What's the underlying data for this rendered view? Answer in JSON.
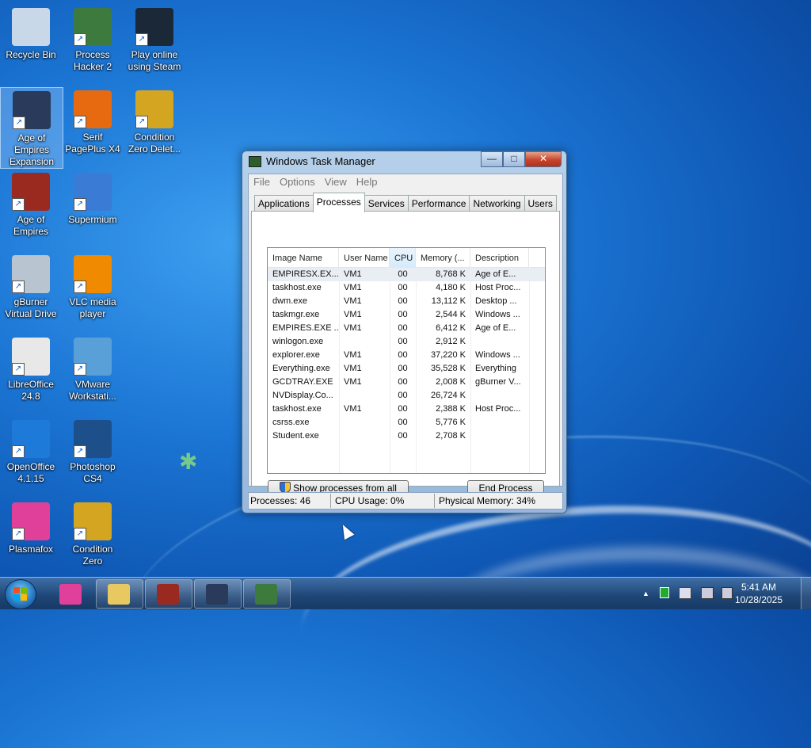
{
  "desktop": {
    "icons": [
      {
        "label": "Recycle Bin",
        "icon": "recycle-bin-icon",
        "color": "#c8d8e8"
      },
      {
        "label": "Process Hacker 2",
        "icon": "process-hacker-icon",
        "color": "#3d7a3d"
      },
      {
        "label": "Play online using Steam",
        "icon": "steam-icon",
        "color": "#1b2838"
      },
      {
        "label": "Age of Empires Expansion",
        "icon": "age-of-empires-expansion-icon",
        "color": "#2a3a5a"
      },
      {
        "label": "Serif PagePlus X4",
        "icon": "pageplus-icon",
        "color": "#e86a10"
      },
      {
        "label": "Condition Zero Delet...",
        "icon": "condition-zero-deleted-icon",
        "color": "#d4a520"
      },
      {
        "label": "Age of Empires",
        "icon": "age-of-empires-icon",
        "color": "#9a2a20"
      },
      {
        "label": "Supermium",
        "icon": "supermium-icon",
        "color": "#3a7bd5"
      },
      {
        "label": "gBurner Virtual Drive",
        "icon": "gburner-icon",
        "color": "#b8c4d0"
      },
      {
        "label": "VLC media player",
        "icon": "vlc-icon",
        "color": "#f08a00"
      },
      {
        "label": "LibreOffice 24.8",
        "icon": "libreoffice-icon",
        "color": "#e8e8e8"
      },
      {
        "label": "VMware Workstati...",
        "icon": "vmware-icon",
        "color": "#5aa0d8"
      },
      {
        "label": "OpenOffice 4.1.15",
        "icon": "openoffice-icon",
        "color": "#1e7ad8"
      },
      {
        "label": "Photoshop CS4",
        "icon": "photoshop-icon",
        "color": "#1d4f8a"
      },
      {
        "label": "Plasmafox",
        "icon": "plasmafox-icon",
        "color": "#e0409a"
      },
      {
        "label": "Condition Zero",
        "icon": "condition-zero-icon",
        "color": "#d4a520"
      }
    ]
  },
  "taskmgr": {
    "title": "Windows Task Manager",
    "window_buttons": {
      "minimize": "—",
      "maximize": "□",
      "close": "✕"
    },
    "menu": [
      "File",
      "Options",
      "View",
      "Help"
    ],
    "tabs": [
      "Applications",
      "Processes",
      "Services",
      "Performance",
      "Networking",
      "Users"
    ],
    "active_tab": "Processes",
    "columns": [
      "Image Name",
      "User Name",
      "CPU",
      "Memory (...",
      "Description"
    ],
    "processes": [
      {
        "name": "EMPIRESX.EX...",
        "user": "VM1",
        "cpu": "00",
        "mem": "8,768 K",
        "desc": "Age of E..."
      },
      {
        "name": "taskhost.exe",
        "user": "VM1",
        "cpu": "00",
        "mem": "4,180 K",
        "desc": "Host Proc..."
      },
      {
        "name": "dwm.exe",
        "user": "VM1",
        "cpu": "00",
        "mem": "13,112 K",
        "desc": "Desktop ..."
      },
      {
        "name": "taskmgr.exe",
        "user": "VM1",
        "cpu": "00",
        "mem": "2,544 K",
        "desc": "Windows ..."
      },
      {
        "name": "EMPIRES.EXE ...",
        "user": "VM1",
        "cpu": "00",
        "mem": "6,412 K",
        "desc": "Age of E..."
      },
      {
        "name": "winlogon.exe",
        "user": "",
        "cpu": "00",
        "mem": "2,912 K",
        "desc": ""
      },
      {
        "name": "explorer.exe",
        "user": "VM1",
        "cpu": "00",
        "mem": "37,220 K",
        "desc": "Windows ..."
      },
      {
        "name": "Everything.exe",
        "user": "VM1",
        "cpu": "00",
        "mem": "35,528 K",
        "desc": "Everything"
      },
      {
        "name": "GCDTRAY.EXE",
        "user": "VM1",
        "cpu": "00",
        "mem": "2,008 K",
        "desc": "gBurner V..."
      },
      {
        "name": "NVDisplay.Co...",
        "user": "",
        "cpu": "00",
        "mem": "26,724 K",
        "desc": ""
      },
      {
        "name": "taskhost.exe",
        "user": "VM1",
        "cpu": "00",
        "mem": "2,388 K",
        "desc": "Host Proc..."
      },
      {
        "name": "csrss.exe",
        "user": "",
        "cpu": "00",
        "mem": "5,776 K",
        "desc": ""
      },
      {
        "name": "Student.exe",
        "user": "",
        "cpu": "00",
        "mem": "2,708 K",
        "desc": ""
      }
    ],
    "show_all_label": "Show processes from all users",
    "end_process_label": "End Process",
    "status": {
      "processes": "Processes: 46",
      "cpu": "CPU Usage: 0%",
      "memory": "Physical Memory: 34%"
    }
  },
  "taskbar": {
    "pinned": [
      {
        "name": "taskbar-plasmafox",
        "icon": "plasmafox-icon",
        "color": "#e0409a"
      },
      {
        "name": "taskbar-explorer",
        "icon": "folder-icon",
        "color": "#e8c860"
      },
      {
        "name": "taskbar-age-of-empires",
        "icon": "age-of-empires-icon",
        "color": "#9a2a20"
      },
      {
        "name": "taskbar-age-of-empires-expansion",
        "icon": "age-of-empires-expansion-icon",
        "color": "#2a3a5a"
      },
      {
        "name": "taskbar-task-manager",
        "icon": "task-manager-icon",
        "color": "#3d7a3d"
      }
    ],
    "tray": {
      "up_arrow": "▲",
      "time": "5:41 AM",
      "date": "10/28/2025"
    }
  }
}
